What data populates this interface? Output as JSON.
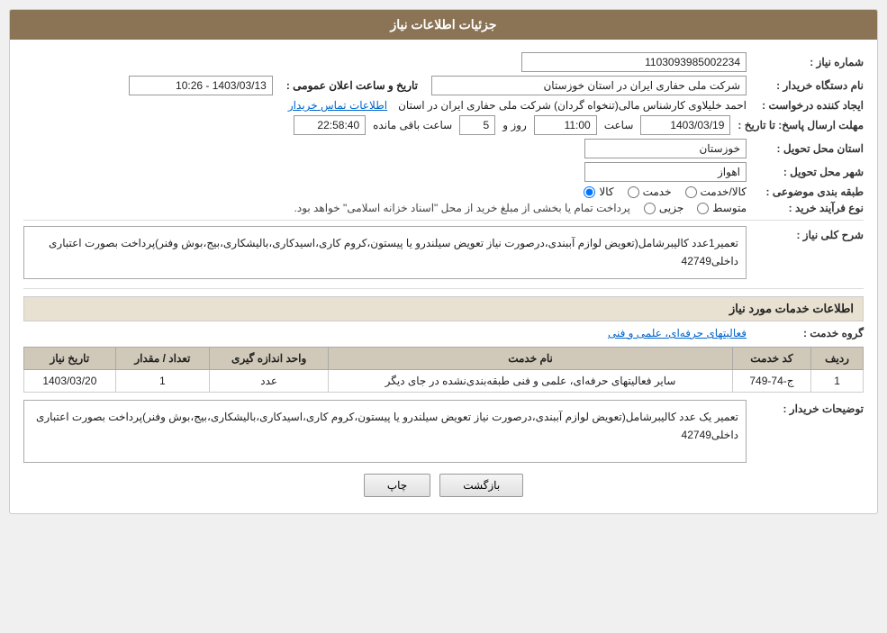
{
  "header": {
    "title": "جزئیات اطلاعات نیاز"
  },
  "fields": {
    "need_number_label": "شماره نیاز :",
    "need_number_value": "1103093985002234",
    "requester_label": "نام دستگاه خریدار :",
    "requester_value": "شرکت ملی حفاری ایران در استان خوزستان",
    "creator_label": "ایجاد کننده درخواست :",
    "creator_value": "احمد خلیلاوی کارشناس مالی(تنخواه گردان) شرکت ملی حفاری ایران در استان",
    "creator_link": "اطلاعات تماس خریدار",
    "deadline_label": "مهلت ارسال پاسخ: تا تاریخ :",
    "deadline_date": "1403/03/19",
    "deadline_time_label": "ساعت",
    "deadline_time": "11:00",
    "deadline_day_label": "روز و",
    "deadline_days": "5",
    "deadline_remaining_label": "ساعت باقی مانده",
    "deadline_remaining": "22:58:40",
    "province_label": "استان محل تحویل :",
    "province_value": "خوزستان",
    "city_label": "شهر محل تحویل :",
    "city_value": "اهواز",
    "category_label": "طبقه بندی موضوعی :",
    "category_options": [
      "کالا",
      "خدمت",
      "کالا/خدمت"
    ],
    "category_selected": "کالا",
    "purchase_type_label": "نوع فرآیند خرید :",
    "purchase_options": [
      "جزیی",
      "متوسط"
    ],
    "purchase_note": "پرداخت تمام یا بخشی از مبلغ خرید از محل \"اسناد خزانه اسلامی\" خواهد بود.",
    "announcement_label": "تاریخ و ساعت اعلان عمومی :",
    "announcement_value": "1403/03/13 - 10:26"
  },
  "need_description": {
    "section_title": "شرح کلی نیاز :",
    "text": "تعمیر1عدد کالیبرشامل(تعویض لوازم آببندی،درصورت نیاز تعویض سیلندرو یا پیستون،کروم کاری،اسیدکاری،بالیشکاری،بیج،بوش وفنر)پرداخت بصورت اعتباری داخلی42749"
  },
  "services_section": {
    "title": "اطلاعات خدمات مورد نیاز",
    "service_group_label": "گروه خدمت :",
    "service_group_value": "فعالیتهای حرفه‌ای، علمی و فنی",
    "table": {
      "headers": [
        "ردیف",
        "کد خدمت",
        "نام خدمت",
        "واحد اندازه گیری",
        "تعداد / مقدار",
        "تاریخ نیاز"
      ],
      "rows": [
        {
          "row_num": "1",
          "service_code": "ج-74-749",
          "service_name": "سایر فعالیتهای حرفه‌ای، علمی و فنی طبقه‌بندی‌نشده در جای دیگر",
          "unit": "عدد",
          "quantity": "1",
          "date": "1403/03/20"
        }
      ]
    }
  },
  "buyer_description": {
    "label": "توضیحات خریدار :",
    "text": "تعمیر یک عدد کالیبرشامل(تعویض لوازم آببندی،درصورت نیاز تعویض سیلندرو یا پیستون،کروم کاری،اسیدکاری،بالیشکاری،بیج،بوش وفنر)پرداخت بصورت اعتباری داخلی42749"
  },
  "buttons": {
    "print_label": "چاپ",
    "back_label": "بازگشت"
  }
}
